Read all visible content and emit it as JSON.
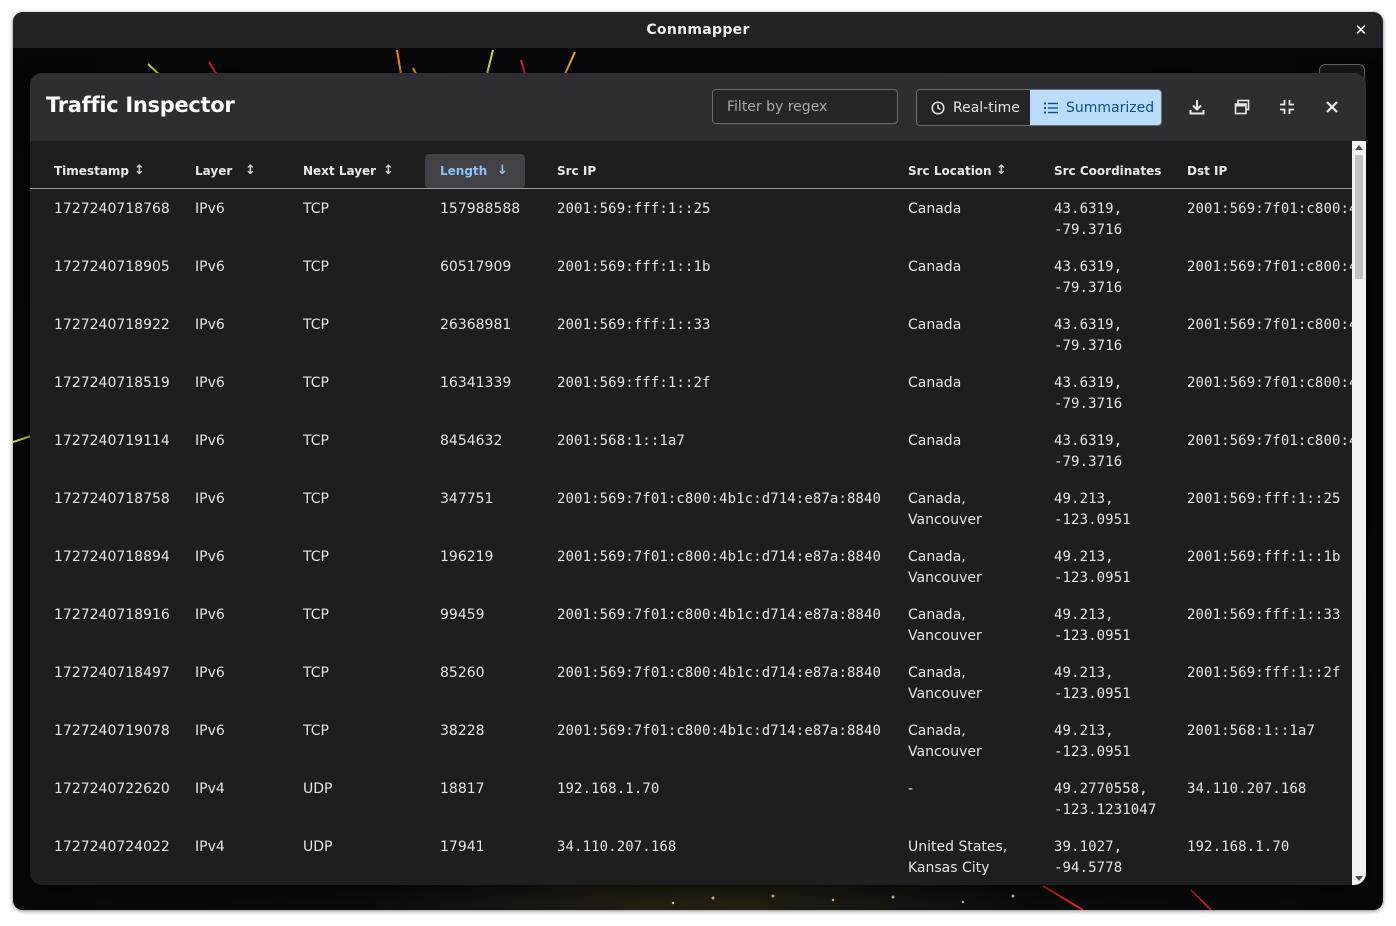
{
  "window": {
    "title": "Connmapper",
    "close_icon": "✕"
  },
  "dialog": {
    "title": "Traffic Inspector",
    "filter_placeholder": "Filter by regex",
    "mode_realtime": "Real-time",
    "mode_summarized": "Summarized",
    "active_mode": "Summarized",
    "accent_color": "#b9dcfb",
    "icons": [
      "download-icon",
      "window-restore-icon",
      "minimize-icon",
      "close-icon"
    ]
  },
  "table": {
    "columns": [
      "Timestamp",
      "Layer",
      "Next Layer",
      "Length",
      "Src IP",
      "Src Location",
      "Src Coordinates",
      "Dst IP"
    ],
    "sort_column": "Length",
    "sort_direction": "descending",
    "rows": [
      {
        "timestamp": "1727240718768",
        "layer": "IPv6",
        "next_layer": "TCP",
        "length": "157988588",
        "src_ip": "2001:569:fff:1::25",
        "src_location_1": "Canada",
        "src_location_2": "",
        "src_coord_1": "43.6319,",
        "src_coord_2": "-79.3716",
        "dst_ip": "2001:569:7f01:c800:4"
      },
      {
        "timestamp": "1727240718905",
        "layer": "IPv6",
        "next_layer": "TCP",
        "length": "60517909",
        "src_ip": "2001:569:fff:1::1b",
        "src_location_1": "Canada",
        "src_location_2": "",
        "src_coord_1": "43.6319,",
        "src_coord_2": "-79.3716",
        "dst_ip": "2001:569:7f01:c800:4"
      },
      {
        "timestamp": "1727240718922",
        "layer": "IPv6",
        "next_layer": "TCP",
        "length": "26368981",
        "src_ip": "2001:569:fff:1::33",
        "src_location_1": "Canada",
        "src_location_2": "",
        "src_coord_1": "43.6319,",
        "src_coord_2": "-79.3716",
        "dst_ip": "2001:569:7f01:c800:4"
      },
      {
        "timestamp": "1727240718519",
        "layer": "IPv6",
        "next_layer": "TCP",
        "length": "16341339",
        "src_ip": "2001:569:fff:1::2f",
        "src_location_1": "Canada",
        "src_location_2": "",
        "src_coord_1": "43.6319,",
        "src_coord_2": "-79.3716",
        "dst_ip": "2001:569:7f01:c800:4"
      },
      {
        "timestamp": "1727240719114",
        "layer": "IPv6",
        "next_layer": "TCP",
        "length": "8454632",
        "src_ip": "2001:568:1::1a7",
        "src_location_1": "Canada",
        "src_location_2": "",
        "src_coord_1": "43.6319,",
        "src_coord_2": "-79.3716",
        "dst_ip": "2001:569:7f01:c800:4"
      },
      {
        "timestamp": "1727240718758",
        "layer": "IPv6",
        "next_layer": "TCP",
        "length": "347751",
        "src_ip": "2001:569:7f01:c800:4b1c:d714:e87a:8840",
        "src_location_1": "Canada,",
        "src_location_2": "Vancouver",
        "src_coord_1": "49.213,",
        "src_coord_2": "-123.0951",
        "dst_ip": "2001:569:fff:1::25"
      },
      {
        "timestamp": "1727240718894",
        "layer": "IPv6",
        "next_layer": "TCP",
        "length": "196219",
        "src_ip": "2001:569:7f01:c800:4b1c:d714:e87a:8840",
        "src_location_1": "Canada,",
        "src_location_2": "Vancouver",
        "src_coord_1": "49.213,",
        "src_coord_2": "-123.0951",
        "dst_ip": "2001:569:fff:1::1b"
      },
      {
        "timestamp": "1727240718916",
        "layer": "IPv6",
        "next_layer": "TCP",
        "length": "99459",
        "src_ip": "2001:569:7f01:c800:4b1c:d714:e87a:8840",
        "src_location_1": "Canada,",
        "src_location_2": "Vancouver",
        "src_coord_1": "49.213,",
        "src_coord_2": "-123.0951",
        "dst_ip": "2001:569:fff:1::33"
      },
      {
        "timestamp": "1727240718497",
        "layer": "IPv6",
        "next_layer": "TCP",
        "length": "85260",
        "src_ip": "2001:569:7f01:c800:4b1c:d714:e87a:8840",
        "src_location_1": "Canada,",
        "src_location_2": "Vancouver",
        "src_coord_1": "49.213,",
        "src_coord_2": "-123.0951",
        "dst_ip": "2001:569:fff:1::2f"
      },
      {
        "timestamp": "1727240719078",
        "layer": "IPv6",
        "next_layer": "TCP",
        "length": "38228",
        "src_ip": "2001:569:7f01:c800:4b1c:d714:e87a:8840",
        "src_location_1": "Canada,",
        "src_location_2": "Vancouver",
        "src_coord_1": "49.213,",
        "src_coord_2": "-123.0951",
        "dst_ip": "2001:568:1::1a7"
      },
      {
        "timestamp": "1727240722620",
        "layer": "IPv4",
        "next_layer": "UDP",
        "length": "18817",
        "src_ip": "192.168.1.70",
        "src_location_1": "-",
        "src_location_2": "",
        "src_coord_1": "49.2770558,",
        "src_coord_2": "-123.1231047",
        "dst_ip": "34.110.207.168"
      },
      {
        "timestamp": "1727240724022",
        "layer": "IPv4",
        "next_layer": "UDP",
        "length": "17941",
        "src_ip": "34.110.207.168",
        "src_location_1": "United States,",
        "src_location_2": "Kansas City",
        "src_coord_1": "39.1027,",
        "src_coord_2": "-94.5778",
        "dst_ip": "192.168.1.70"
      }
    ]
  }
}
